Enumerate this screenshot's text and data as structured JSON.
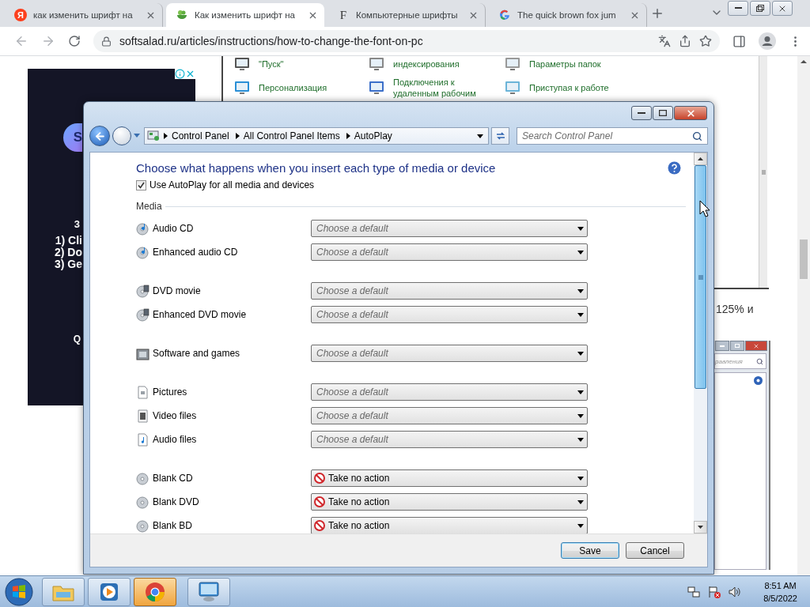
{
  "browser": {
    "tabs": [
      {
        "title": "как изменить шрифт на",
        "kind": "yandex",
        "icon_text": "Я",
        "selected": false
      },
      {
        "title": "Как изменить шрифт на",
        "kind": "leaf",
        "selected": true
      },
      {
        "title": "Компьютерные шрифты",
        "kind": "letter",
        "icon_text": "F",
        "selected": false
      },
      {
        "title": "The quick brown fox jum",
        "kind": "google",
        "selected": false
      }
    ],
    "url": "softsalad.ru/articles/instructions/how-to-change-the-font-on-pc"
  },
  "page": {
    "ad": {
      "badge": "S",
      "heading": "3",
      "steps": [
        "1) Cli",
        "2) Do",
        "3) Ge"
      ],
      "footer": "Q"
    },
    "screenshot_items": [
      [
        {
          "label": "\"Пуск\"",
          "kind": "taskbar"
        },
        {
          "label": "индексирования",
          "kind": "indexing"
        },
        {
          "label": "Параметры папок",
          "kind": "folder"
        }
      ],
      [
        {
          "label": "Персонализация",
          "kind": "display"
        },
        {
          "label": "Подключения к удаленным рабочим",
          "kind": "remote"
        },
        {
          "label": "Приступая к работе",
          "kind": "start"
        }
      ]
    ],
    "caption": "125% и",
    "inner_window": {
      "search_placeholder": "равления"
    }
  },
  "dialog": {
    "breadcrumbs": [
      "Control Panel",
      "All Control Panel Items",
      "AutoPlay"
    ],
    "search_placeholder": "Search Control Panel",
    "heading": "Choose what happens when you insert each type of media or device",
    "use_autoplay": {
      "label": "Use AutoPlay for all media and devices",
      "checked": true
    },
    "section": "Media",
    "groups": [
      {
        "items": [
          {
            "label": "Audio CD",
            "kind": "music-disc",
            "choice": "Choose a default",
            "no_action": false
          },
          {
            "label": "Enhanced audio CD",
            "kind": "music-disc",
            "choice": "Choose a default",
            "no_action": false
          }
        ]
      },
      {
        "items": [
          {
            "label": "DVD movie",
            "kind": "film-disc",
            "choice": "Choose a default",
            "no_action": false
          },
          {
            "label": "Enhanced DVD movie",
            "kind": "film-disc",
            "choice": "Choose a default",
            "no_action": false
          }
        ]
      },
      {
        "items": [
          {
            "label": "Software and games",
            "kind": "software",
            "choice": "Choose a default",
            "no_action": false
          }
        ]
      },
      {
        "items": [
          {
            "label": "Pictures",
            "kind": "picture-file",
            "choice": "Choose a default",
            "no_action": false
          },
          {
            "label": "Video files",
            "kind": "video-file",
            "choice": "Choose a default",
            "no_action": false
          },
          {
            "label": "Audio files",
            "kind": "audio-file",
            "choice": "Choose a default",
            "no_action": false
          }
        ]
      },
      {
        "items": [
          {
            "label": "Blank CD",
            "kind": "disc",
            "choice": "Take no action",
            "no_action": true
          },
          {
            "label": "Blank DVD",
            "kind": "disc",
            "choice": "Take no action",
            "no_action": true
          },
          {
            "label": "Blank BD",
            "kind": "disc",
            "choice": "Take no action",
            "no_action": true
          }
        ]
      }
    ],
    "buttons": [
      {
        "label": "Save",
        "default": true
      },
      {
        "label": "Cancel",
        "default": false
      }
    ]
  },
  "taskbar": {
    "apps": [
      {
        "kind": "explorer",
        "selected": false
      },
      {
        "kind": "media",
        "selected": false
      },
      {
        "kind": "chrome",
        "selected": true
      },
      {
        "kind": "control-panel",
        "selected": false
      }
    ],
    "time": "8:51 AM",
    "date": "8/5/2022"
  }
}
